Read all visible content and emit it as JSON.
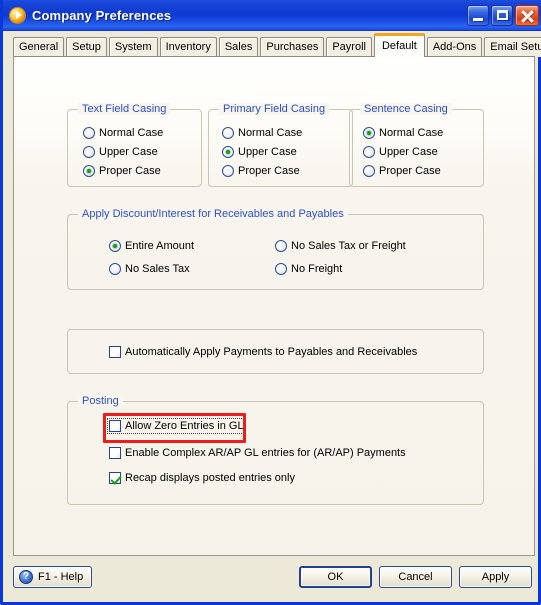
{
  "window": {
    "title": "Company Preferences",
    "app_icon": "play-circle-icon",
    "minimize_label": "Minimize",
    "maximize_label": "Maximize",
    "close_label": "Close"
  },
  "tabs": [
    {
      "label": "General",
      "active": false
    },
    {
      "label": "Setup",
      "active": false
    },
    {
      "label": "System",
      "active": false
    },
    {
      "label": "Inventory",
      "active": false
    },
    {
      "label": "Sales",
      "active": false
    },
    {
      "label": "Purchases",
      "active": false
    },
    {
      "label": "Payroll",
      "active": false
    },
    {
      "label": "Default",
      "active": true
    },
    {
      "label": "Add-Ons",
      "active": false
    },
    {
      "label": "Email Setup",
      "active": false
    }
  ],
  "groups": {
    "text_field_casing": {
      "title": "Text Field Casing",
      "options": [
        {
          "label": "Normal Case",
          "selected": false
        },
        {
          "label": "Upper Case",
          "selected": false
        },
        {
          "label": "Proper Case",
          "selected": true
        }
      ]
    },
    "primary_field_casing": {
      "title": "Primary Field Casing",
      "options": [
        {
          "label": "Normal Case",
          "selected": false
        },
        {
          "label": "Upper Case",
          "selected": true
        },
        {
          "label": "Proper Case",
          "selected": false
        }
      ]
    },
    "sentence_casing": {
      "title": "Sentence Casing",
      "options": [
        {
          "label": "Normal Case",
          "selected": true
        },
        {
          "label": "Upper Case",
          "selected": false
        },
        {
          "label": "Proper Case",
          "selected": false
        }
      ]
    },
    "apply_discount": {
      "title": "Apply Discount/Interest for Receivables and Payables",
      "options_left": [
        {
          "label": "Entire Amount",
          "selected": true
        },
        {
          "label": "No Sales Tax",
          "selected": false
        }
      ],
      "options_right": [
        {
          "label": "No Sales Tax or Freight",
          "selected": false
        },
        {
          "label": "No Freight",
          "selected": false
        }
      ]
    },
    "auto_apply": {
      "checkbox": {
        "label": "Automatically Apply Payments to Payables and Receivables",
        "checked": false
      }
    },
    "posting": {
      "title": "Posting",
      "checkboxes": [
        {
          "label": "Allow Zero Entries in GL",
          "checked": false,
          "focused": true,
          "highlighted": true
        },
        {
          "label": "Enable Complex AR/AP  GL entries for (AR/AP)  Payments",
          "checked": false,
          "focused": false,
          "highlighted": false
        },
        {
          "label": "Recap displays posted entries only",
          "checked": true,
          "focused": false,
          "highlighted": false
        }
      ]
    }
  },
  "footer": {
    "help_label": "F1 - Help",
    "help_icon": "question-mark-icon",
    "ok_label": "OK",
    "cancel_label": "Cancel",
    "apply_label": "Apply"
  },
  "colors": {
    "title_bar": "#0d39d4",
    "active_tab_accent": "#f0a81e",
    "group_label": "#2b4fcf",
    "radio_dot": "#1a9a1a",
    "check_mark": "#17a017",
    "annotation": "#ee1c1c",
    "panel_bg": "#f6f4ec"
  }
}
